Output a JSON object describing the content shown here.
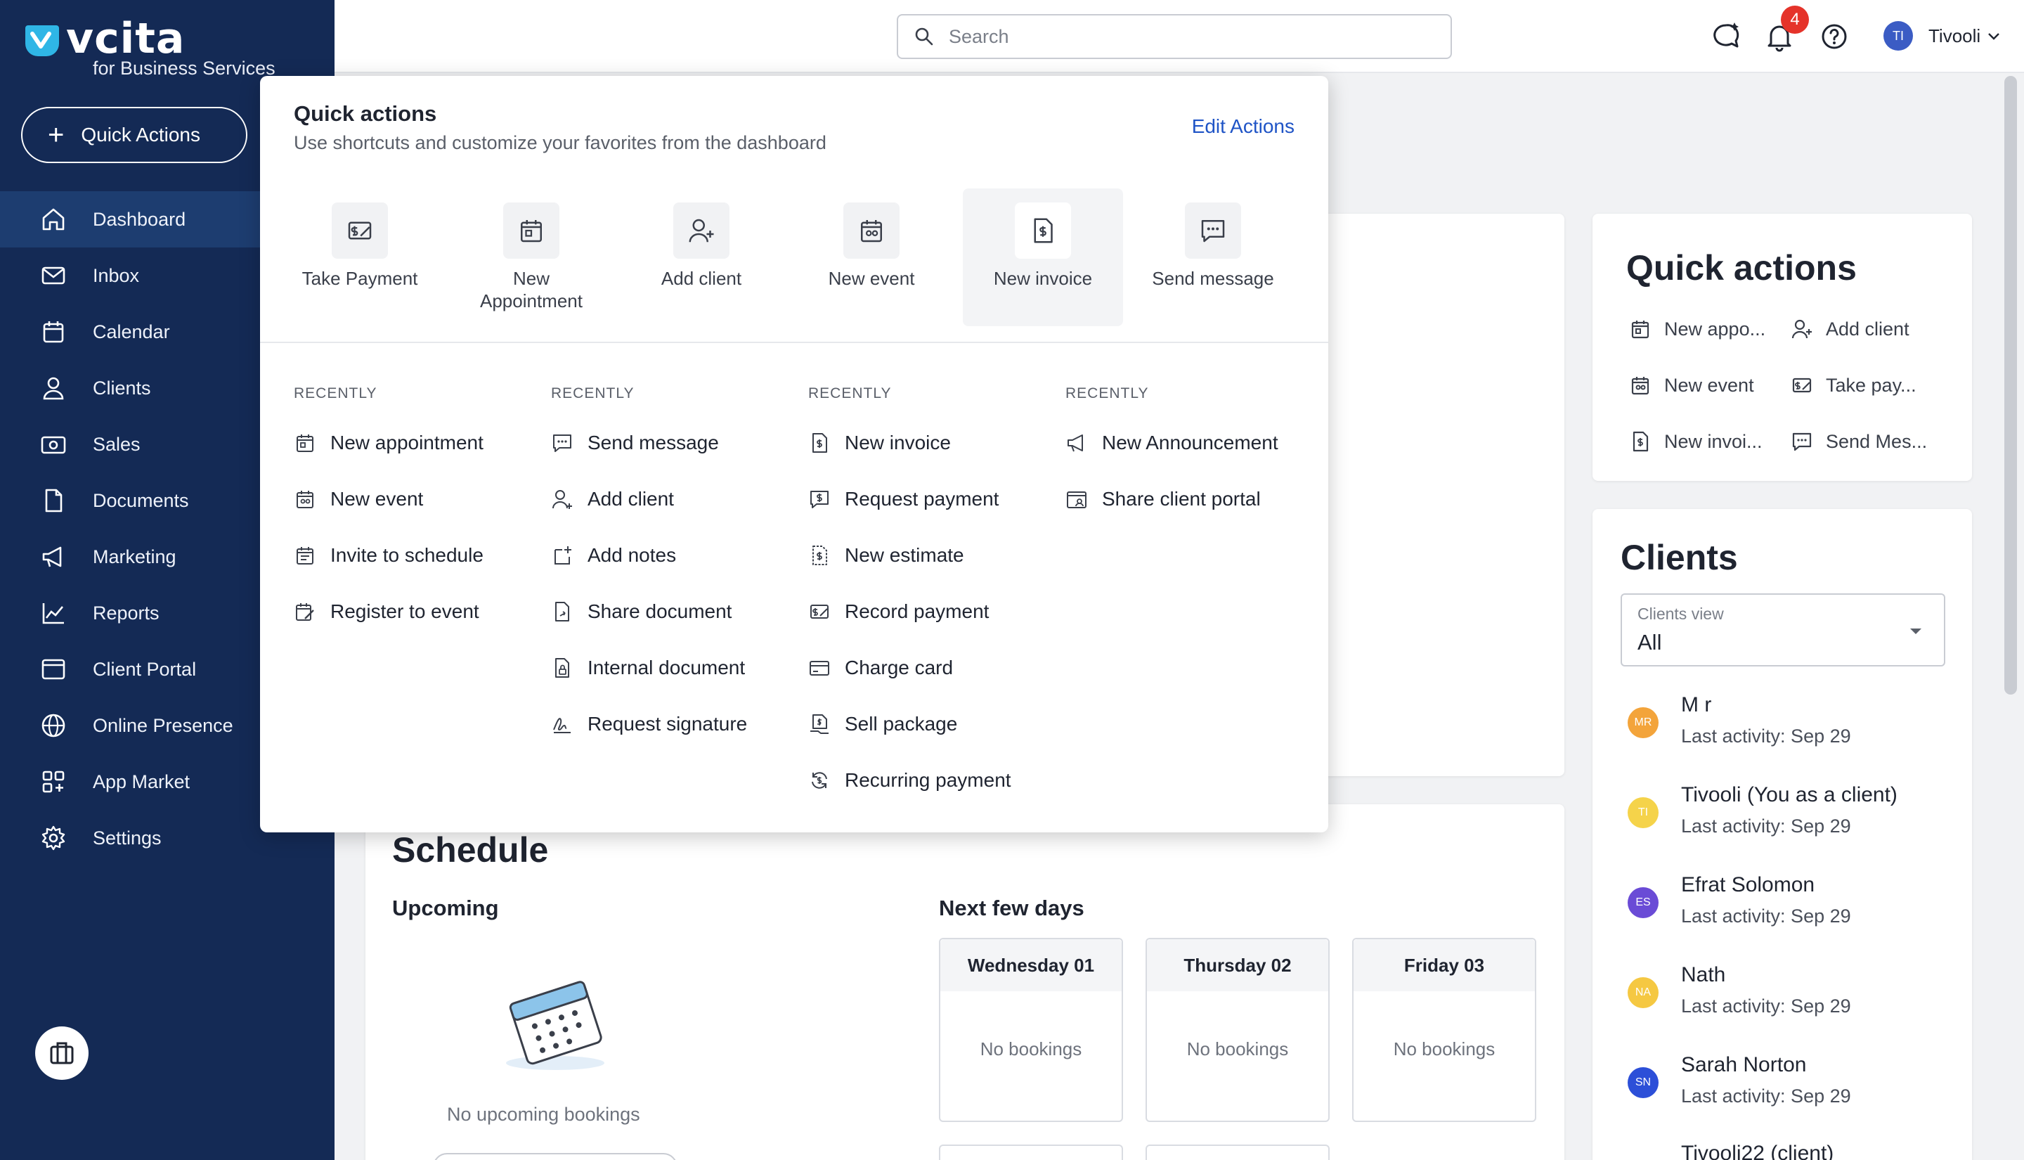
{
  "brand": {
    "name": "vcita",
    "sub": "for Business Services"
  },
  "sidebar": {
    "quick_actions_label": "Quick Actions",
    "items": [
      {
        "label": "Dashboard",
        "icon": "home-icon"
      },
      {
        "label": "Inbox",
        "icon": "mail-icon"
      },
      {
        "label": "Calendar",
        "icon": "calendar-icon"
      },
      {
        "label": "Clients",
        "icon": "person-icon"
      },
      {
        "label": "Sales",
        "icon": "money-icon"
      },
      {
        "label": "Documents",
        "icon": "document-icon"
      },
      {
        "label": "Marketing",
        "icon": "megaphone-icon"
      },
      {
        "label": "Reports",
        "icon": "chart-icon"
      },
      {
        "label": "Client Portal",
        "icon": "portal-icon"
      },
      {
        "label": "Online Presence",
        "icon": "globe-icon"
      },
      {
        "label": "App Market",
        "icon": "apps-icon"
      },
      {
        "label": "Settings",
        "icon": "gear-icon"
      }
    ]
  },
  "topbar": {
    "search_placeholder": "Search",
    "notifications_count": "4",
    "user_initials": "TI",
    "user_name": "Tivooli"
  },
  "popup": {
    "title": "Quick actions",
    "subtitle": "Use shortcuts and customize your favorites from the dashboard",
    "edit_label": "Edit Actions",
    "shortcuts": [
      {
        "label": "Take Payment"
      },
      {
        "label": "New Appointment"
      },
      {
        "label": "Add client"
      },
      {
        "label": "New event"
      },
      {
        "label": "New invoice"
      },
      {
        "label": "Send message"
      }
    ],
    "recently_label": "RECENTLY",
    "columns": [
      [
        "New appointment",
        "New event",
        "Invite to schedule",
        "Register to event"
      ],
      [
        "Send message",
        "Add client",
        "Add notes",
        "Share document",
        "Internal document",
        "Request signature"
      ],
      [
        "New invoice",
        "Request payment",
        "New estimate",
        "Record payment",
        "Charge card",
        "Sell package",
        "Recurring payment"
      ],
      [
        "New Announcement",
        "Share client portal"
      ]
    ]
  },
  "schedule": {
    "title": "Schedule",
    "upcoming": "Upcoming",
    "no_upcoming": "No upcoming bookings",
    "next_days": "Next few days",
    "days": [
      {
        "name": "Wednesday 01",
        "status": "No bookings"
      },
      {
        "name": "Thursday 02",
        "status": "No bookings"
      },
      {
        "name": "Friday 03",
        "status": "No bookings"
      }
    ]
  },
  "side_quick_actions": {
    "title": "Quick actions",
    "items": [
      "New appo...",
      "Add client",
      "New event",
      "Take pay...",
      "New invoi...",
      "Send Mes..."
    ]
  },
  "clients": {
    "title": "Clients",
    "view_label": "Clients view",
    "view_value": "All",
    "list": [
      {
        "initials": "MR",
        "name": "M r",
        "activity": "Last activity: Sep 29",
        "color": "#f3a43b"
      },
      {
        "initials": "TI",
        "name": "Tivooli (You as a client)",
        "activity": "Last activity: Sep 29",
        "color": "#f5d34a"
      },
      {
        "initials": "ES",
        "name": "Efrat Solomon",
        "activity": "Last activity: Sep 29",
        "color": "#6a4bd6"
      },
      {
        "initials": "NA",
        "name": "Nath",
        "activity": "Last activity: Sep 29",
        "color": "#f5c842"
      },
      {
        "initials": "SN",
        "name": "Sarah Norton",
        "activity": "Last activity: Sep 29",
        "color": "#2c4fd8"
      },
      {
        "initials": "",
        "name": "Tivooli22 (client)",
        "activity": "",
        "color": "#888888"
      }
    ]
  }
}
